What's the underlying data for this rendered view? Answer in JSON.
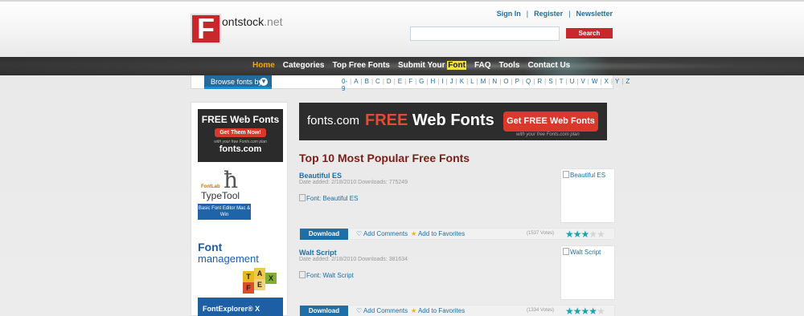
{
  "logo": {
    "letter": "F",
    "name": "ontstock",
    "tld": ".net"
  },
  "toplinks": {
    "signin": "Sign In",
    "register": "Register",
    "newsletter": "Newsletter",
    "sep": "|"
  },
  "search": {
    "value": "",
    "button": "Search"
  },
  "nav": {
    "items": [
      "Home",
      "Categories",
      "Top Free Fonts"
    ],
    "submit_prefix": "Submit Your ",
    "submit_highlight": "Font",
    "faq": "FAQ",
    "tools": "Tools",
    "contact": "Contact Us",
    "active": "Home"
  },
  "browse": {
    "label": "Browse fonts by",
    "letters": [
      "0-9",
      "A",
      "B",
      "C",
      "D",
      "E",
      "F",
      "G",
      "H",
      "I",
      "J",
      "K",
      "L",
      "M",
      "N",
      "O",
      "P",
      "Q",
      "R",
      "S",
      "T",
      "U",
      "V",
      "W",
      "X",
      "Y",
      "Z"
    ]
  },
  "sidebar_ads": {
    "ad1": {
      "title": "FREE Web Fonts",
      "button": "Get Them Now!",
      "sub": "with your free Fonts.com plan",
      "brand": "fonts.com"
    },
    "ad2": {
      "brand": "FontLab",
      "product": "TypeTool",
      "tagline": "Basic Font Editor Mac & Win"
    },
    "ad3": {
      "title1": "Font",
      "title2": "management",
      "product": "FontExplorer® X"
    }
  },
  "banner": {
    "brand": "fonts.com",
    "free": "FREE",
    "webfonts": " Web Fonts",
    "cta": "Get FREE Web Fonts",
    "sub": "with your free Fonts.com plan"
  },
  "section_title": "Top 10 Most Popular Free Fonts",
  "fonts": [
    {
      "name": "Beautiful ES",
      "meta": "Date added: 2/18/2010   Downloads: 775249",
      "preview": "Font: Beautiful ES",
      "thumb": "Beautiful ES",
      "download": "Download",
      "comments": "Add Comments",
      "favorites": "Add to Favorites",
      "votes": "(1537 Votes)",
      "rating": 3
    },
    {
      "name": "Walt Script",
      "meta": "Date added: 2/18/2010   Downloads: 381634",
      "preview": "Font: Walt Script",
      "thumb": "Walt Script",
      "download": "Download",
      "comments": "Add Comments",
      "favorites": "Add to Favorites",
      "votes": "(1334 Votes)",
      "rating": 4
    }
  ],
  "colors": {
    "brand_red": "#c8282b",
    "link_blue": "#1b6fa6",
    "nav_active": "#f7a600",
    "heading": "#7b1e17",
    "star": "#19a3b3"
  }
}
